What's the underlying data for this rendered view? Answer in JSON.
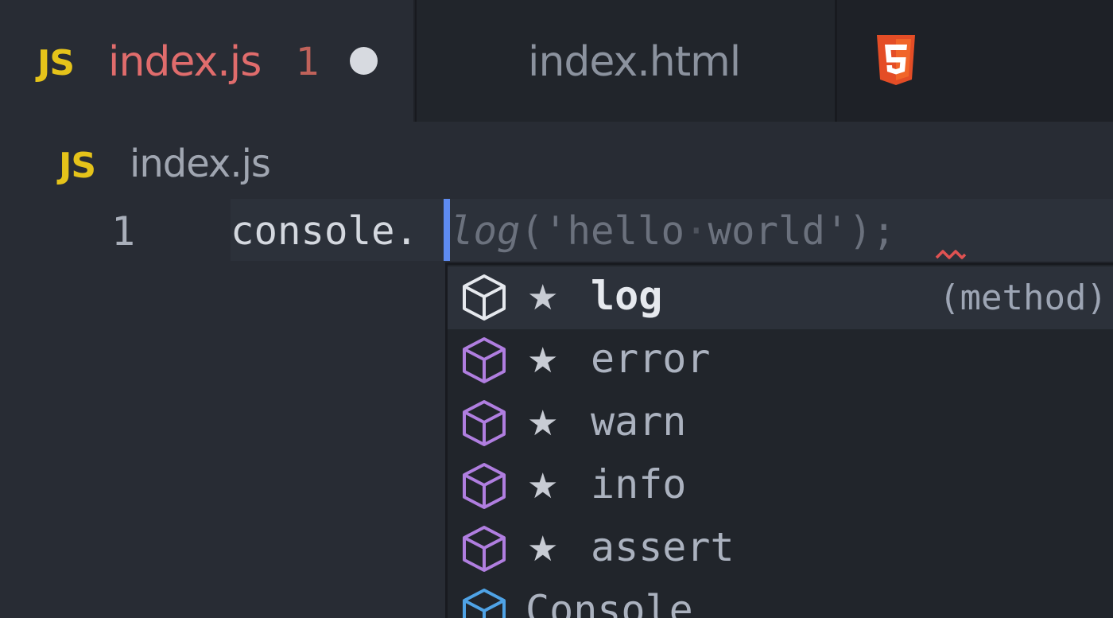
{
  "tabs": [
    {
      "badge": "JS",
      "title": "index.js",
      "problems": "1"
    },
    {
      "icon": "html5-icon",
      "title": "index.html"
    }
  ],
  "breadcrumb": {
    "badge": "JS",
    "file": "index.js"
  },
  "editor": {
    "line_number": "1",
    "typed": "console.",
    "ghost_method": "log",
    "ghost_open": "('hello",
    "ghost_space": "·",
    "ghost_rest": "world');"
  },
  "suggest": {
    "items": [
      {
        "star": "★",
        "label": "log",
        "detail": "(method)"
      },
      {
        "star": "★",
        "label": "error"
      },
      {
        "star": "★",
        "label": "warn"
      },
      {
        "star": "★",
        "label": "info"
      },
      {
        "star": "★",
        "label": "assert"
      },
      {
        "label": "Console"
      }
    ]
  },
  "colors": {
    "js_badge": "#e5c31a",
    "tab_active_title": "#e06c6c",
    "cursor": "#5e8bf0",
    "cube_method": "#b07ee0",
    "cube_module": "#4fa3e6",
    "html5": "#e44d26"
  }
}
